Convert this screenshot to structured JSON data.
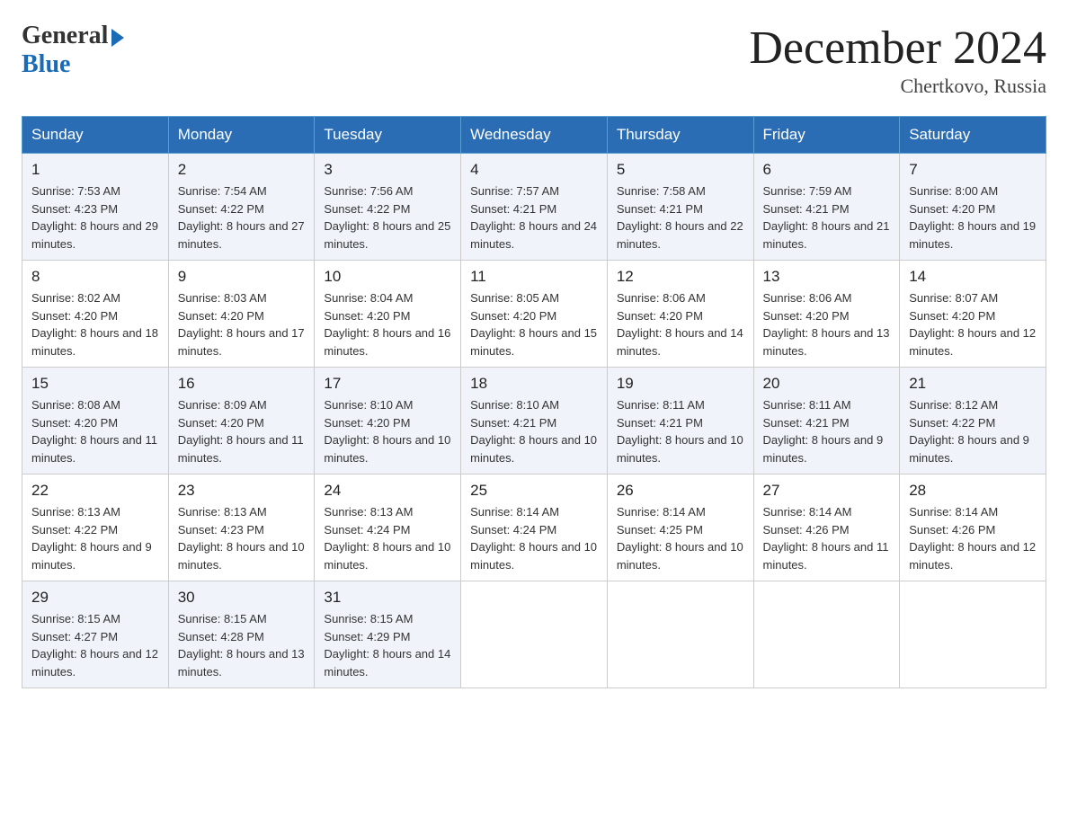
{
  "logo": {
    "general": "General",
    "blue": "Blue"
  },
  "title": "December 2024",
  "location": "Chertkovo, Russia",
  "days_of_week": [
    "Sunday",
    "Monday",
    "Tuesday",
    "Wednesday",
    "Thursday",
    "Friday",
    "Saturday"
  ],
  "weeks": [
    [
      {
        "day": "1",
        "sunrise": "7:53 AM",
        "sunset": "4:23 PM",
        "daylight": "8 hours and 29 minutes."
      },
      {
        "day": "2",
        "sunrise": "7:54 AM",
        "sunset": "4:22 PM",
        "daylight": "8 hours and 27 minutes."
      },
      {
        "day": "3",
        "sunrise": "7:56 AM",
        "sunset": "4:22 PM",
        "daylight": "8 hours and 25 minutes."
      },
      {
        "day": "4",
        "sunrise": "7:57 AM",
        "sunset": "4:21 PM",
        "daylight": "8 hours and 24 minutes."
      },
      {
        "day": "5",
        "sunrise": "7:58 AM",
        "sunset": "4:21 PM",
        "daylight": "8 hours and 22 minutes."
      },
      {
        "day": "6",
        "sunrise": "7:59 AM",
        "sunset": "4:21 PM",
        "daylight": "8 hours and 21 minutes."
      },
      {
        "day": "7",
        "sunrise": "8:00 AM",
        "sunset": "4:20 PM",
        "daylight": "8 hours and 19 minutes."
      }
    ],
    [
      {
        "day": "8",
        "sunrise": "8:02 AM",
        "sunset": "4:20 PM",
        "daylight": "8 hours and 18 minutes."
      },
      {
        "day": "9",
        "sunrise": "8:03 AM",
        "sunset": "4:20 PM",
        "daylight": "8 hours and 17 minutes."
      },
      {
        "day": "10",
        "sunrise": "8:04 AM",
        "sunset": "4:20 PM",
        "daylight": "8 hours and 16 minutes."
      },
      {
        "day": "11",
        "sunrise": "8:05 AM",
        "sunset": "4:20 PM",
        "daylight": "8 hours and 15 minutes."
      },
      {
        "day": "12",
        "sunrise": "8:06 AM",
        "sunset": "4:20 PM",
        "daylight": "8 hours and 14 minutes."
      },
      {
        "day": "13",
        "sunrise": "8:06 AM",
        "sunset": "4:20 PM",
        "daylight": "8 hours and 13 minutes."
      },
      {
        "day": "14",
        "sunrise": "8:07 AM",
        "sunset": "4:20 PM",
        "daylight": "8 hours and 12 minutes."
      }
    ],
    [
      {
        "day": "15",
        "sunrise": "8:08 AM",
        "sunset": "4:20 PM",
        "daylight": "8 hours and 11 minutes."
      },
      {
        "day": "16",
        "sunrise": "8:09 AM",
        "sunset": "4:20 PM",
        "daylight": "8 hours and 11 minutes."
      },
      {
        "day": "17",
        "sunrise": "8:10 AM",
        "sunset": "4:20 PM",
        "daylight": "8 hours and 10 minutes."
      },
      {
        "day": "18",
        "sunrise": "8:10 AM",
        "sunset": "4:21 PM",
        "daylight": "8 hours and 10 minutes."
      },
      {
        "day": "19",
        "sunrise": "8:11 AM",
        "sunset": "4:21 PM",
        "daylight": "8 hours and 10 minutes."
      },
      {
        "day": "20",
        "sunrise": "8:11 AM",
        "sunset": "4:21 PM",
        "daylight": "8 hours and 9 minutes."
      },
      {
        "day": "21",
        "sunrise": "8:12 AM",
        "sunset": "4:22 PM",
        "daylight": "8 hours and 9 minutes."
      }
    ],
    [
      {
        "day": "22",
        "sunrise": "8:13 AM",
        "sunset": "4:22 PM",
        "daylight": "8 hours and 9 minutes."
      },
      {
        "day": "23",
        "sunrise": "8:13 AM",
        "sunset": "4:23 PM",
        "daylight": "8 hours and 10 minutes."
      },
      {
        "day": "24",
        "sunrise": "8:13 AM",
        "sunset": "4:24 PM",
        "daylight": "8 hours and 10 minutes."
      },
      {
        "day": "25",
        "sunrise": "8:14 AM",
        "sunset": "4:24 PM",
        "daylight": "8 hours and 10 minutes."
      },
      {
        "day": "26",
        "sunrise": "8:14 AM",
        "sunset": "4:25 PM",
        "daylight": "8 hours and 10 minutes."
      },
      {
        "day": "27",
        "sunrise": "8:14 AM",
        "sunset": "4:26 PM",
        "daylight": "8 hours and 11 minutes."
      },
      {
        "day": "28",
        "sunrise": "8:14 AM",
        "sunset": "4:26 PM",
        "daylight": "8 hours and 12 minutes."
      }
    ],
    [
      {
        "day": "29",
        "sunrise": "8:15 AM",
        "sunset": "4:27 PM",
        "daylight": "8 hours and 12 minutes."
      },
      {
        "day": "30",
        "sunrise": "8:15 AM",
        "sunset": "4:28 PM",
        "daylight": "8 hours and 13 minutes."
      },
      {
        "day": "31",
        "sunrise": "8:15 AM",
        "sunset": "4:29 PM",
        "daylight": "8 hours and 14 minutes."
      },
      null,
      null,
      null,
      null
    ]
  ]
}
